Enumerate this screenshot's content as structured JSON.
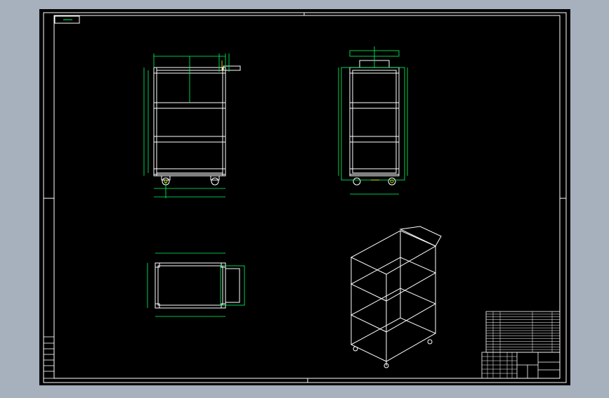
{
  "colors": {
    "background": "#a7b0bd",
    "sheet": "#000000",
    "line": "#ffffff",
    "dimension": "#00ff66",
    "cyan": "#00e5ff",
    "yellow": "#ffff00",
    "red": "#ff3030"
  },
  "drawing": {
    "title_tag": "",
    "parts_header": [
      "",
      "",
      "",
      ""
    ],
    "parts_rows": [
      "",
      "",
      "",
      "",
      "",
      "",
      "",
      "",
      "",
      "",
      "",
      "",
      "",
      ""
    ],
    "title_block_cells": [
      "",
      "",
      "",
      "",
      ""
    ],
    "revision_cells": [
      "",
      "",
      "",
      "",
      "",
      "",
      ""
    ]
  }
}
